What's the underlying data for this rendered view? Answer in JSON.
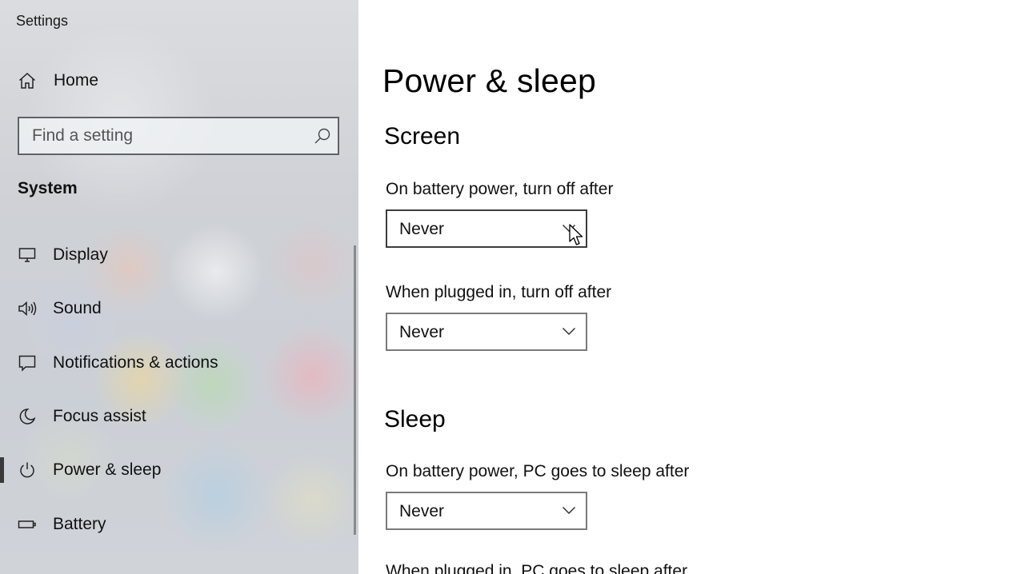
{
  "window": {
    "app_title": "Settings"
  },
  "sidebar": {
    "home": {
      "label": "Home",
      "icon": "home-icon"
    },
    "search": {
      "placeholder": "Find a setting",
      "icon": "search-icon"
    },
    "section_heading": "System",
    "items": [
      {
        "label": "Display",
        "icon": "display-icon",
        "selected": false
      },
      {
        "label": "Sound",
        "icon": "sound-icon",
        "selected": false
      },
      {
        "label": "Notifications & actions",
        "icon": "notifications-icon",
        "selected": false
      },
      {
        "label": "Focus assist",
        "icon": "focus-assist-icon",
        "selected": false
      },
      {
        "label": "Power & sleep",
        "icon": "power-icon",
        "selected": true
      },
      {
        "label": "Battery",
        "icon": "battery-icon",
        "selected": false
      }
    ]
  },
  "main": {
    "page_title": "Power & sleep",
    "screen": {
      "heading": "Screen",
      "battery_label": "On battery power, turn off after",
      "battery_value": "Never",
      "plugged_label": "When plugged in, turn off after",
      "plugged_value": "Never"
    },
    "sleep": {
      "heading": "Sleep",
      "battery_label": "On battery power, PC goes to sleep after",
      "battery_value": "Never",
      "plugged_label": "When plugged in, PC goes to sleep after"
    }
  },
  "colors": {
    "selected_indicator": "#3a3a3a",
    "dropdown_border": "#7a7a7a",
    "content_background": "#ffffff"
  }
}
